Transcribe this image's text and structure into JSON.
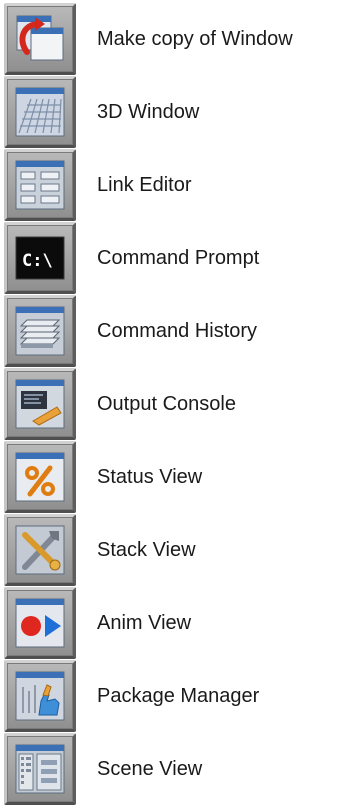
{
  "menu": {
    "items": [
      {
        "label": "Make copy of Window",
        "icon": "copy-window-icon"
      },
      {
        "label": "3D Window",
        "icon": "3d-window-icon"
      },
      {
        "label": "Link Editor",
        "icon": "link-editor-icon"
      },
      {
        "label": "Command Prompt",
        "icon": "command-prompt-icon"
      },
      {
        "label": "Command History",
        "icon": "command-history-icon"
      },
      {
        "label": "Output Console",
        "icon": "output-console-icon"
      },
      {
        "label": "Status View",
        "icon": "status-view-icon"
      },
      {
        "label": "Stack View",
        "icon": "stack-view-icon"
      },
      {
        "label": "Anim View",
        "icon": "anim-view-icon"
      },
      {
        "label": "Package Manager",
        "icon": "package-manager-icon"
      },
      {
        "label": "Scene View",
        "icon": "scene-view-icon"
      }
    ]
  },
  "icon_glyphs": {
    "command_prompt_text": "C:\\"
  },
  "colors": {
    "icon_window_title": "#3b6fb6",
    "icon_frame": "#9a9a9a",
    "label_text": "#1a1a1a",
    "anim_record": "#e0271f",
    "anim_play": "#1e6fd6",
    "status_percent": "#e07d10",
    "copy_arrow": "#d5281d"
  }
}
